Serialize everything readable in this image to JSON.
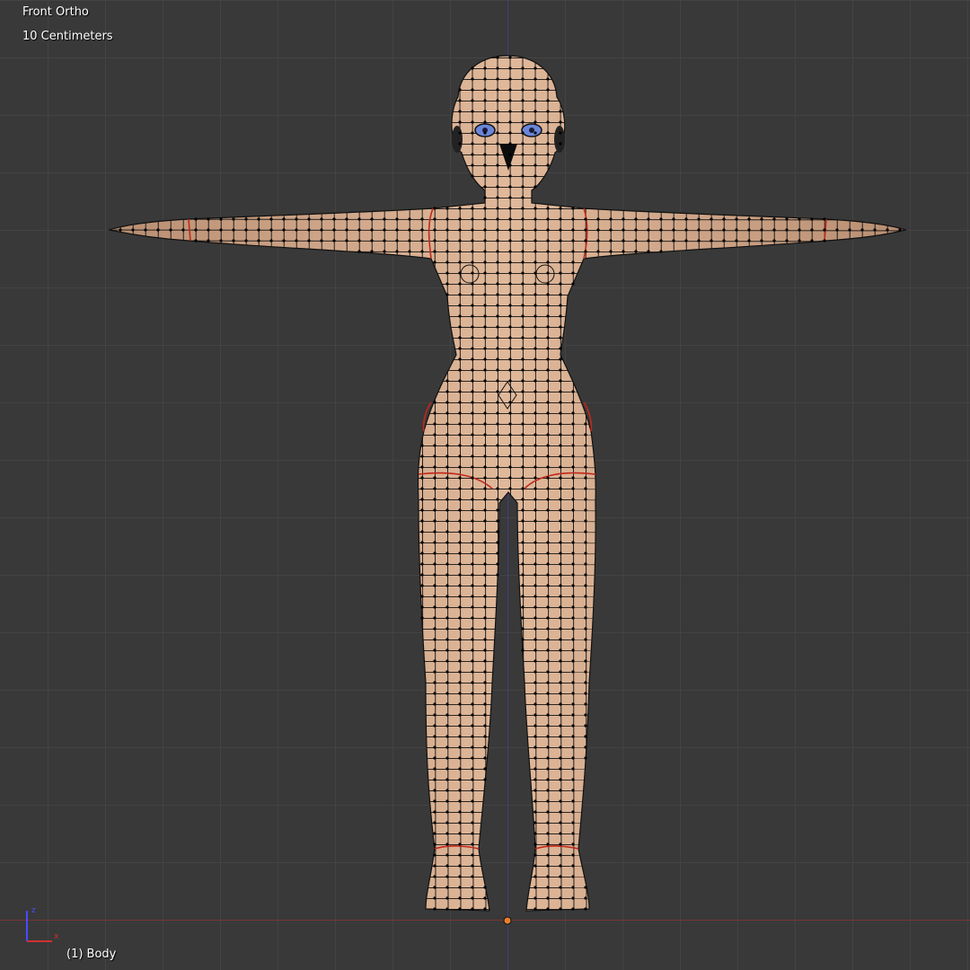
{
  "viewport": {
    "view_name": "Front Ortho",
    "grid_scale": "10 Centimeters",
    "object_info": "(1) Body"
  },
  "colors": {
    "background": "#393939",
    "grid": "#434343",
    "skin": "#d4a88a",
    "wire": "#111111",
    "seam": "#c0281c",
    "eye": "#6a86d8",
    "z_axis": "#3e3e8a",
    "x_axis": "#7a3535",
    "origin": "#e8802a"
  },
  "icons": {
    "axis_gizmo": "axis-gizmo-icon",
    "origin": "object-origin-icon"
  }
}
